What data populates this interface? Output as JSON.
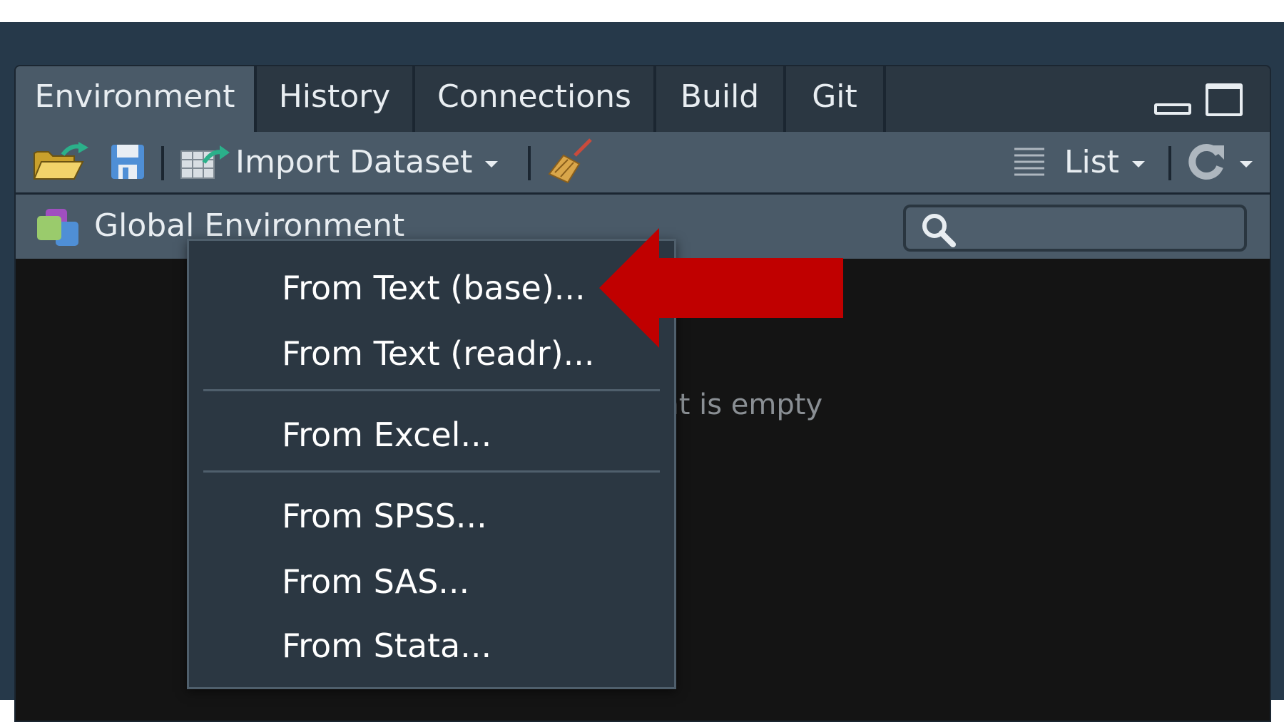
{
  "tabs": [
    {
      "label": "Environment",
      "active": true
    },
    {
      "label": "History",
      "active": false
    },
    {
      "label": "Connections",
      "active": false
    },
    {
      "label": "Build",
      "active": false
    },
    {
      "label": "Git",
      "active": false
    }
  ],
  "toolbar": {
    "import_label": "Import Dataset",
    "view_label": "List"
  },
  "env": {
    "label": "Global Environment",
    "empty_message": "Environment is empty"
  },
  "menu": {
    "items": [
      "From Text (base)...",
      "From Text (readr)...",
      "From Excel...",
      "From SPSS...",
      "From SAS...",
      "From Stata..."
    ]
  },
  "annotation": {
    "arrow_color": "#c00000",
    "points_to": "From Text (readr)..."
  }
}
